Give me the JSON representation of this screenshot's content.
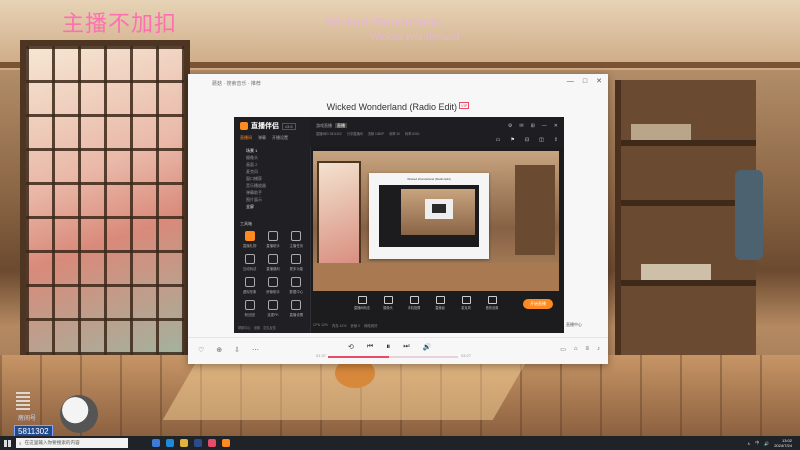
{
  "overlay": {
    "streamer_tag": "主播不加扣",
    "song_title": "Wicked Wonderland",
    "song_artist": "Wicked Wonderland"
  },
  "player": {
    "top_text": "蘑菇 · 搜索音乐 · 推荐",
    "window_controls": [
      "—",
      "□",
      "✕"
    ],
    "title": "Wicked Wonderland (Radio Edit)",
    "tag": "VIP",
    "bottom_left": [
      "♡",
      "⊕",
      "⇩",
      "⋯"
    ],
    "controls": {
      "mode": "⟲",
      "prev": "⏮",
      "play": "⏸",
      "next": "⏭",
      "volume": "🔊"
    },
    "progress": 0.47,
    "time_elapsed": "01:37",
    "time_total": "03:27",
    "bottom_right": [
      "▭",
      "⌂",
      "≡",
      "♪"
    ]
  },
  "stream_app": {
    "brand": "直播伴侣",
    "version": "v3.6",
    "tabs": [
      "直播间",
      "弹幕",
      "开播设置"
    ],
    "scenes": [
      "场景 1",
      "摄像头",
      "画面 2",
      "麦克风",
      "窗口捕获",
      "音乐播放器",
      "弹幕助手",
      "图片展示",
      "全屏"
    ],
    "tools_label": "工具箱",
    "tools": [
      {
        "label": "直播礼物",
        "hot": true
      },
      {
        "label": "直播助手",
        "hot": false
      },
      {
        "label": "主播任务",
        "hot": false
      },
      {
        "label": "互动玩法",
        "hot": false
      },
      {
        "label": "直播福利",
        "hot": false
      },
      {
        "label": "更多功能",
        "hot": false
      },
      {
        "label": "虚拟形象",
        "hot": false
      },
      {
        "label": "房管助手",
        "hot": false
      },
      {
        "label": "数据中心",
        "hot": false
      },
      {
        "label": "粉丝团",
        "hot": false
      },
      {
        "label": "连麦PK",
        "hot": false
      },
      {
        "label": "直播设置",
        "hot": false
      }
    ],
    "side_footer": [
      "帮助中心",
      "设置",
      "意见反馈"
    ],
    "header_title": "游戏直播",
    "header_badge": "直播",
    "header_info": [
      "直播间ID 3811302",
      "分享直播间",
      "流畅 1080P",
      "帧率 30",
      "码率 6000"
    ],
    "header_icons": [
      "⚙",
      "✉",
      "⊞",
      "—",
      "✕"
    ],
    "header_icons2": [
      "▭",
      "⚑",
      "⊡",
      "◫",
      "⇪"
    ],
    "preview_title": "Wicked Wonderland (Radio Edit)",
    "controls": [
      "直播间玩法",
      "摄像头",
      "手机投屏",
      "直播窗",
      "麦克风",
      "音效设置"
    ],
    "go_live": "开始直播",
    "footer": [
      "CPU 12%",
      "内存 41%",
      "丢帧 0",
      "网络良好"
    ]
  },
  "help_chip": "直播中心",
  "viewer": {
    "label": "房间号",
    "id": "5811302"
  },
  "taskbar": {
    "search_placeholder": "在这里输入你要搜索的内容",
    "tray": [
      "∧",
      "中",
      "🔊"
    ],
    "time": "13:02",
    "date": "2024/7/24"
  },
  "colors": {
    "accent": "#ff8a1f",
    "overlay_pink": "#ff6fb0",
    "player_accent": "#e84a6a"
  }
}
